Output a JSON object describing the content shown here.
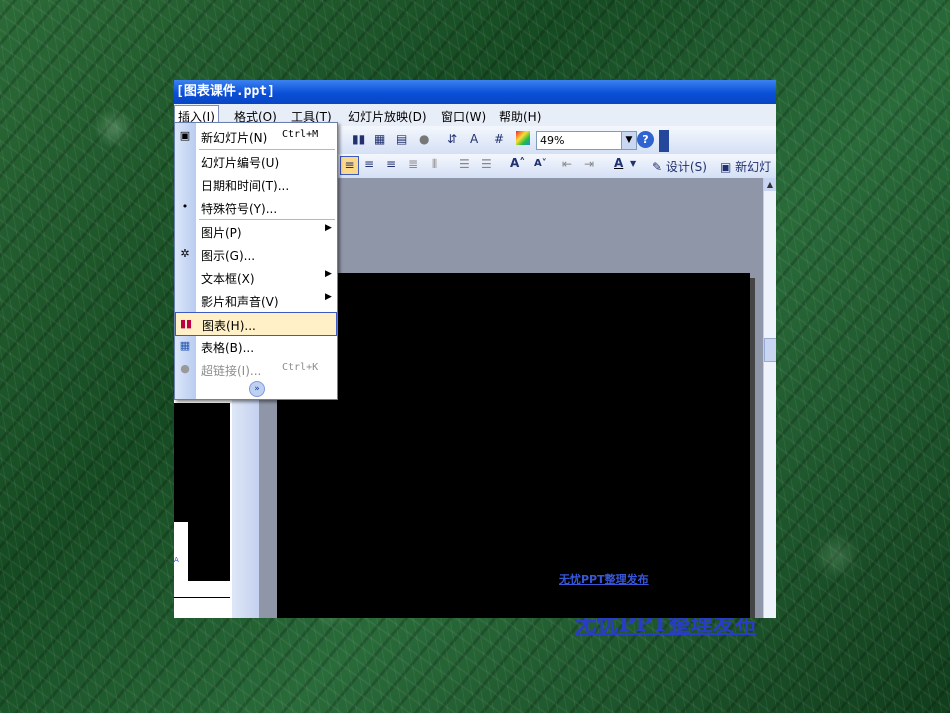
{
  "window": {
    "title": "[图表课件.ppt]"
  },
  "menubar": {
    "items": [
      "插入(I)",
      "格式(O)",
      "工具(T)",
      "幻灯片放映(D)",
      "窗口(W)",
      "帮助(H)"
    ]
  },
  "toolbar": {
    "zoom_value": "49%",
    "design_label": "设计(S)",
    "new_slide_label": "新幻灯"
  },
  "insert_menu": {
    "items": [
      {
        "label": "新幻灯片(N)",
        "shortcut": "Ctrl+M",
        "icon": "new-slide-icon"
      },
      {
        "label": "幻灯片编号(U)"
      },
      {
        "label": "日期和时间(T)..."
      },
      {
        "label": "特殊符号(Y)...",
        "icon": "bullet-icon"
      },
      {
        "label": "图片(P)",
        "submenu": true
      },
      {
        "label": "图示(G)...",
        "icon": "diagram-icon"
      },
      {
        "label": "文本框(X)",
        "submenu": true
      },
      {
        "label": "影片和声音(V)",
        "submenu": true
      },
      {
        "label": "图表(H)...",
        "icon": "chart-icon",
        "highlighted": true
      },
      {
        "label": "表格(B)...",
        "icon": "table-icon"
      },
      {
        "label": "超链接(I)...",
        "shortcut": "Ctrl+K",
        "icon": "hyperlink-icon",
        "disabled": true
      }
    ]
  },
  "slide": {
    "footer_link": "无忧PPT整理发布"
  },
  "page": {
    "caption": "无忧PPT整理发布"
  },
  "colors": {
    "background": "#1f5a2c",
    "title_bar": "#0a4fd8",
    "menu_highlight": "#fff0c8"
  }
}
